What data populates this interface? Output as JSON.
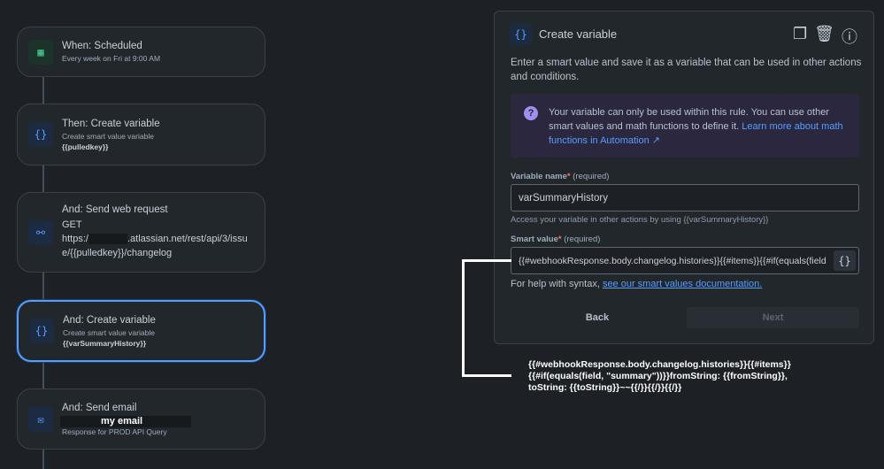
{
  "flow": {
    "cards": [
      {
        "title": "When: Scheduled",
        "sub": "Every week on Fri at 9:00 AM",
        "icon": "calendar-icon"
      },
      {
        "title": "Then: Create variable",
        "sub": "Create smart value variable",
        "bold": "{{pulledkey}}",
        "icon": "braces-icon"
      },
      {
        "title": "And: Send web request",
        "method": "GET",
        "url_pre": "https:/",
        "url_post": ".atlassian.net/rest/api/3/issue/{{pulledkey}}/changelog",
        "icon": "webhook-icon"
      },
      {
        "title": "And: Create variable",
        "sub": "Create smart value variable",
        "bold": "{{varSummaryHistory}}",
        "icon": "braces-icon"
      },
      {
        "title": "And: Send email",
        "redacted_label": "my email",
        "sub": "Response for PROD API Query",
        "icon": "mail-icon"
      }
    ]
  },
  "panel": {
    "title": "Create variable",
    "description": "Enter a smart value and save it as a variable that can be used in other actions and conditions.",
    "info_text": "Your variable can only be used within this rule. You can use other smart values and math functions to define it. ",
    "info_link": "Learn more about math functions in Automation ↗",
    "var_label": "Variable name",
    "required": "(required)",
    "var_value": "varSummaryHistory",
    "var_hint": "Access your variable in other actions by using {{varSummaryHistory}}",
    "smart_label": "Smart value",
    "smart_value": "{{#webhookResponse.body.changelog.histories}}{{#items}}{{#if(equals(field",
    "help_pre": "For help with syntax, ",
    "help_link": "see our smart values documentation.",
    "back": "Back",
    "next": "Next"
  },
  "annotation": "{{#webhookResponse.body.changelog.histories}}{{#items}} {{#if(equals(field, \"summary\"))}}fromString: {{fromString}}, toString: {{toString}}~~{{/}}{{/}}{{/}}",
  "colors": {
    "accent": "#579dff",
    "bg": "#1d2125",
    "card": "#22272b"
  }
}
